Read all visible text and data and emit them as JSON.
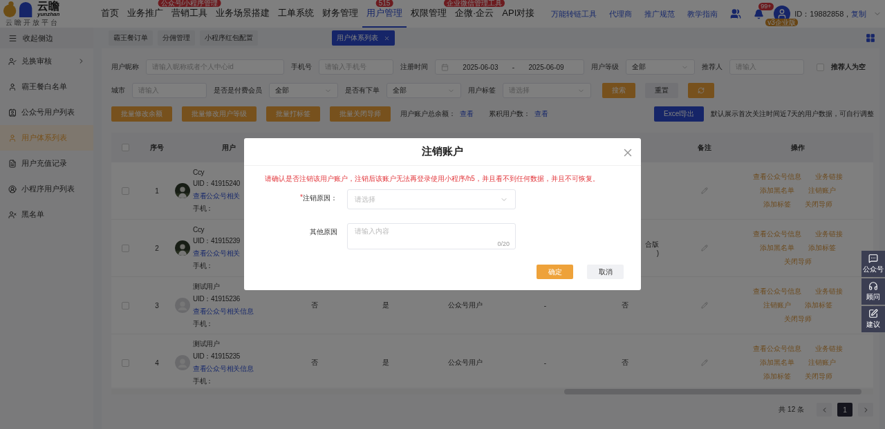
{
  "header": {
    "logo": {
      "name": "云瞻",
      "latin": "yunzhan",
      "subtitle": "云瞻开放平台"
    },
    "nav": [
      {
        "label": "首页",
        "selected": false
      },
      {
        "label": "业务推广",
        "selected": false
      },
      {
        "label": "营销工具",
        "selected": false,
        "badge": "公众号/小程序管理"
      },
      {
        "label": "业务场景搭建",
        "selected": false
      },
      {
        "label": "工单系统",
        "selected": false
      },
      {
        "label": "财务管理",
        "selected": false
      },
      {
        "label": "用户管理",
        "selected": true,
        "badge": "515"
      },
      {
        "label": "权限管理",
        "selected": false
      },
      {
        "label": "企微·企云",
        "selected": false,
        "badge": "企业微信管理工具"
      },
      {
        "label": "API对接",
        "selected": false
      }
    ],
    "links": [
      "万能转链工具",
      "代理商",
      "推广规范",
      "教学指南"
    ],
    "notifications": "99+",
    "plan": "v3企业版",
    "account_id": "ID：19882858，",
    "copy": "复制"
  },
  "sidebar": {
    "collapse": "收起侧边",
    "items": [
      {
        "label": "兑换审核",
        "selected": false,
        "expandable": true
      },
      {
        "label": "霸王餐白名单",
        "selected": false,
        "expandable": false
      },
      {
        "label": "公众号用户列表",
        "selected": false,
        "expandable": false
      },
      {
        "label": "用户体系列表",
        "selected": true,
        "expandable": false
      },
      {
        "label": "用户充值记录",
        "selected": false,
        "expandable": false
      },
      {
        "label": "小程序用户列表",
        "selected": false,
        "expandable": false
      },
      {
        "label": "黑名单",
        "selected": false,
        "expandable": false
      }
    ]
  },
  "tabs": [
    {
      "label": "霸王餐订单",
      "selected": false,
      "closable": false
    },
    {
      "label": "分佣管理",
      "selected": false,
      "closable": false
    },
    {
      "label": "小程序红包配置",
      "selected": false,
      "closable": false
    },
    {
      "label": "用户体系列表",
      "selected": true,
      "closable": true
    }
  ],
  "filters": {
    "row1": [
      {
        "kind": "input",
        "label": "用户昵称",
        "placeholder": "请输入昵称或者个人中心id"
      },
      {
        "kind": "input",
        "label": "手机号",
        "placeholder": "请输入手机号"
      },
      {
        "kind": "date",
        "label": "注册时间",
        "start": "2025-06-03",
        "separator": "-",
        "end": "2025-06-09"
      },
      {
        "kind": "select",
        "label": "用户等级",
        "value": "全部"
      },
      {
        "kind": "input",
        "label": "推荐人",
        "placeholder": "请输入"
      }
    ],
    "empty_referrer": {
      "label": "推荐人为空",
      "checked": false
    },
    "row2": [
      {
        "kind": "input",
        "label": "城市",
        "placeholder": "请输入"
      },
      {
        "kind": "select",
        "label": "是否是付费会员",
        "value": "全部"
      },
      {
        "kind": "select",
        "label": "是否有下单",
        "value": "全部"
      },
      {
        "kind": "select",
        "label": "用户标签",
        "placeholder": "请选择"
      }
    ],
    "search": "搜索",
    "reset": "重置"
  },
  "actions": {
    "batch": [
      "批量修改余额",
      "批量修改用户等级",
      "批量打标签",
      "批量关闭导师"
    ],
    "stats": [
      {
        "label": "用户账户总余额：",
        "link": "查看"
      },
      {
        "label": "累积用户数：",
        "link": "查看"
      }
    ],
    "export": "Excel导出",
    "note": "默认展示首次关注时间近7天的用户数据，可自行调整"
  },
  "table": {
    "all_checked": false,
    "columns": [
      {
        "label": "序号"
      },
      {
        "label": "用户"
      },
      {},
      {},
      {},
      {},
      {},
      {
        "label": "备注"
      },
      {
        "label": "操作"
      }
    ],
    "rows": [
      {
        "checked": false,
        "index": "1",
        "avatar": {
          "kind": "picture"
        },
        "name": "Ccy",
        "uid": "UID：41915240",
        "link": "查看公众号相关",
        "phone": "手机：",
        "cells": [],
        "actions": [
          "查看公众号信息",
          "业务链接",
          "添加黑名单",
          "注销账户",
          "添加标签",
          "关闭导师"
        ]
      },
      {
        "checked": false,
        "index": "2",
        "avatar": {
          "kind": "picture"
        },
        "name": "Ccy",
        "uid": "UID：41915239",
        "link": "查看公众号相关",
        "phone": "手机：",
        "cells": [
          null,
          null,
          null,
          null,
          [
            "合版",
            ")"
          ]
        ],
        "actions": [
          "查看公众号信息",
          "业务链接",
          "添加黑名单",
          "添加标签",
          "关闭导师"
        ]
      },
      {
        "checked": false,
        "index": "3",
        "avatar": {
          "kind": "icon"
        },
        "name": "测试用户",
        "uid": "UID：41915236",
        "link": "查看公众号相关信息",
        "phone": "手机：",
        "cells": [
          "否",
          "是",
          "公众号用户",
          "-",
          "否"
        ],
        "actions": [
          "查看公众号信息",
          "业务链接",
          "注销账户",
          "添加标签",
          "关闭导师"
        ]
      },
      {
        "checked": false,
        "index": "4",
        "avatar": {
          "kind": "icon"
        },
        "name": "测试用户",
        "uid": "UID：41915235",
        "link": "查看公众号相关信息",
        "phone": "手机：",
        "cells": [
          "否",
          "是",
          "公众号用户",
          "-",
          "否"
        ],
        "actions": [
          "查看公众号信息",
          "业务链接",
          "添加黑名单",
          "注销账户",
          "添加标签",
          "关闭导师"
        ]
      }
    ]
  },
  "pagination": {
    "total": "共 12 条",
    "pages": [
      {
        "label": "1",
        "selected": true
      }
    ]
  },
  "dialog": {
    "title": "注销账户",
    "warning": "请确认是否注销该用户账户，注销后该账户无法再登录使用小程序/h5，并且看不到任何数据，并且不可恢复。",
    "fields": [
      {
        "kind": "select",
        "mark": "*",
        "label": "注销原因：",
        "placeholder": "请选择"
      },
      {
        "kind": "textarea",
        "label": "其他原因",
        "placeholder": "请输入内容",
        "counter": "0/20"
      }
    ],
    "confirm": "确定",
    "cancel": "取消"
  },
  "float_tools": [
    "公众号",
    "顾问",
    "建议"
  ]
}
